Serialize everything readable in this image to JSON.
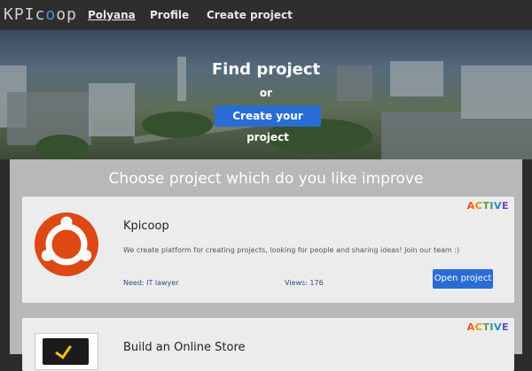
{
  "navbar": {
    "logo_left": "KPIc",
    "logo_o": "o",
    "logo_right": "op",
    "links": [
      {
        "label": "Polyana",
        "active": true
      },
      {
        "label": "Profile",
        "active": false
      },
      {
        "label": "Create project",
        "active": false
      }
    ]
  },
  "hero": {
    "title": "Find project",
    "or": "or",
    "create_button": "Create your project"
  },
  "main": {
    "heading": "Choose project which do you like improve",
    "projects": [
      {
        "name": "Kpicoop",
        "description": "We create platform for creating projects, looking for people and sharing ideas! Join our team :)",
        "need": "Need: IT lawyer",
        "views": "Views: 176",
        "open_button": "Open project",
        "badge": "ACTIVE",
        "icon": "ubuntu-logo-icon"
      },
      {
        "name": "Build an Online Store",
        "badge": "ACTIVE",
        "icon": "laptop-check-icon"
      }
    ]
  },
  "colors": {
    "accent": "#2a6cd6",
    "ubuntu_orange": "#dd4814",
    "navbar": "#2e2e2e",
    "panel": "#b8b8b8",
    "card": "#ececec"
  }
}
